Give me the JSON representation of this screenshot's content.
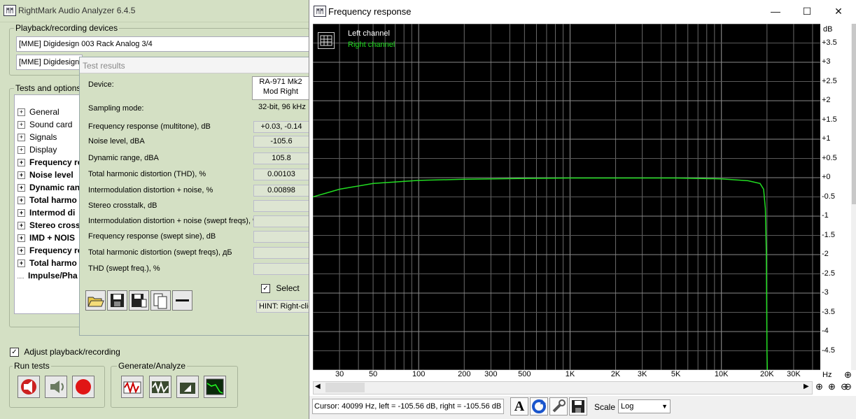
{
  "main_window": {
    "title": "RightMark Audio Analyzer 6.4.5",
    "logo_text": "ᛗᛗ",
    "playback_group": "Playback/recording devices",
    "playback_device": "[MME] Digidesign 003 Rack Analog 3/4",
    "recording_device": "[MME] Digidesign",
    "tests_group": "Tests and options",
    "tree": [
      {
        "label": "General",
        "bold": false
      },
      {
        "label": "Sound card",
        "bold": false
      },
      {
        "label": "Signals",
        "bold": false
      },
      {
        "label": "Display",
        "bold": false
      },
      {
        "label": "Frequency re",
        "bold": true
      },
      {
        "label": "Noise level",
        "bold": true
      },
      {
        "label": "Dynamic ran",
        "bold": true
      },
      {
        "label": "Total harmo",
        "bold": true
      },
      {
        "label": "Intermod di",
        "bold": true
      },
      {
        "label": "Stereo cross",
        "bold": true
      },
      {
        "label": "IMD + NOIS",
        "bold": true
      },
      {
        "label": "Frequency re",
        "bold": true
      },
      {
        "label": "Total harmo",
        "bold": true
      },
      {
        "label": "Impulse/Pha",
        "bold": true
      }
    ],
    "adjust_label": "Adjust playback/recording",
    "run_tests_group": "Run tests",
    "generate_group": "Generate/Analyze"
  },
  "results": {
    "title": "Test results",
    "device_label": "Device:",
    "device_value_line1": "RA-971 Mk2",
    "device_value_line2": "Mod Right",
    "sampling_label": "Sampling mode:",
    "sampling_value": "32-bit, 96 kHz",
    "rows": [
      {
        "label": "Frequency response (multitone), dB",
        "value": "+0.03, -0.14"
      },
      {
        "label": "Noise level, dBA",
        "value": "-105.6"
      },
      {
        "label": "Dynamic range, dBA",
        "value": "105.8"
      },
      {
        "label": "Total harmonic distortion (THD), %",
        "value": "0.00103"
      },
      {
        "label": "Intermodulation distortion + noise, %",
        "value": "0.00898"
      },
      {
        "label": "Stereo crosstalk, dB",
        "value": ""
      },
      {
        "label": "Intermodulation distortion + noise (swept freqs), %",
        "value": ""
      },
      {
        "label": "Frequency response (swept sine), dB",
        "value": ""
      },
      {
        "label": "Total harmonic distortion (swept freqs), дБ",
        "value": ""
      },
      {
        "label": "THD (swept freq.), %",
        "value": ""
      }
    ],
    "select_label": "Select",
    "hint": "HINT: Right-clic"
  },
  "freq_window": {
    "title": "Frequency response",
    "minimize": "—",
    "maximize": "☐",
    "close": "✕",
    "legend_left": "Left channel",
    "legend_right": "Right channel",
    "left_color": "#ffffff",
    "right_color": "#22dd22",
    "y_unit": "dB",
    "x_unit": "Hz",
    "y_ticks": [
      "+3.5",
      "+3",
      "+2.5",
      "+2",
      "+1.5",
      "+1",
      "+0.5",
      "+0",
      "-0.5",
      "-1",
      "-1.5",
      "-2",
      "-2.5",
      "-3",
      "-3.5",
      "-4",
      "-4.5"
    ],
    "x_ticks": [
      "30",
      "50",
      "100",
      "200",
      "300",
      "500",
      "1K",
      "2K",
      "3K",
      "5K",
      "10K",
      "20K",
      "30K"
    ],
    "cursor_text": "Cursor:  40099 Hz,  left = -105.56 dB,  right = -105.56 dB",
    "scale_label": "Scale",
    "scale_value": "Log"
  },
  "chart_data": {
    "type": "line",
    "xlabel": "Hz",
    "ylabel": "dB",
    "ylim": [
      -5,
      4
    ],
    "x_scale": "log",
    "series": [
      {
        "name": "Right channel",
        "x": [
          20,
          30,
          50,
          100,
          200,
          500,
          1000,
          2000,
          5000,
          10000,
          15000,
          18000,
          19000,
          19500,
          19800,
          20000,
          20100
        ],
        "y": [
          -0.5,
          -0.3,
          -0.15,
          -0.07,
          -0.04,
          -0.02,
          -0.01,
          -0.01,
          -0.01,
          -0.03,
          -0.08,
          -0.15,
          -0.3,
          -0.8,
          -2.0,
          -4.5,
          -5
        ]
      }
    ],
    "grid": true
  }
}
